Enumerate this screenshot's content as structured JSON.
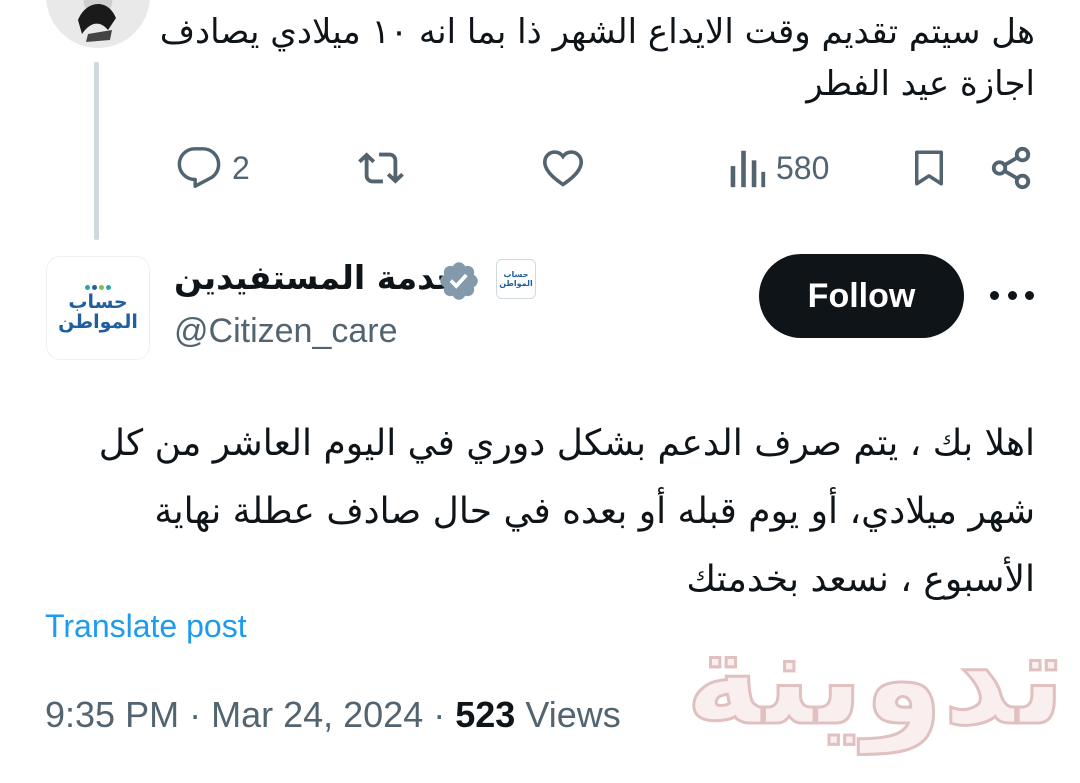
{
  "parent_reply": {
    "text": "هل سيتم تقديم وقت الايداع الشهر ذا بما انه ١٠ ميلادي يصادف اجازة عيد الفطر"
  },
  "actions": {
    "reply_count": "2",
    "views_count": "580"
  },
  "author": {
    "logo_line_1": "حساب",
    "logo_line_2": "المواطن",
    "name": "خدمة المستفيدين",
    "handle": "@Citizen_care",
    "follow_label": "Follow"
  },
  "tweet": {
    "text": "اهلا بك ، يتم صرف الدعم بشكل دوري في اليوم العاشر من كل شهر ميلادي، أو يوم قبله أو بعده في حال صادف عطلة نهاية الأسبوع ، نسعد بخدمتك",
    "translate_label": "Translate post",
    "time": "9:35 PM",
    "date": "Mar 24, 2024",
    "views_count": "523",
    "views_label": "Views"
  },
  "watermark": {
    "text": "تدوينة"
  },
  "colors": {
    "accent": "#1d9bf0",
    "text_primary": "#0f1419",
    "text_secondary": "#536471",
    "logo_blue": "#1f5f9e"
  }
}
